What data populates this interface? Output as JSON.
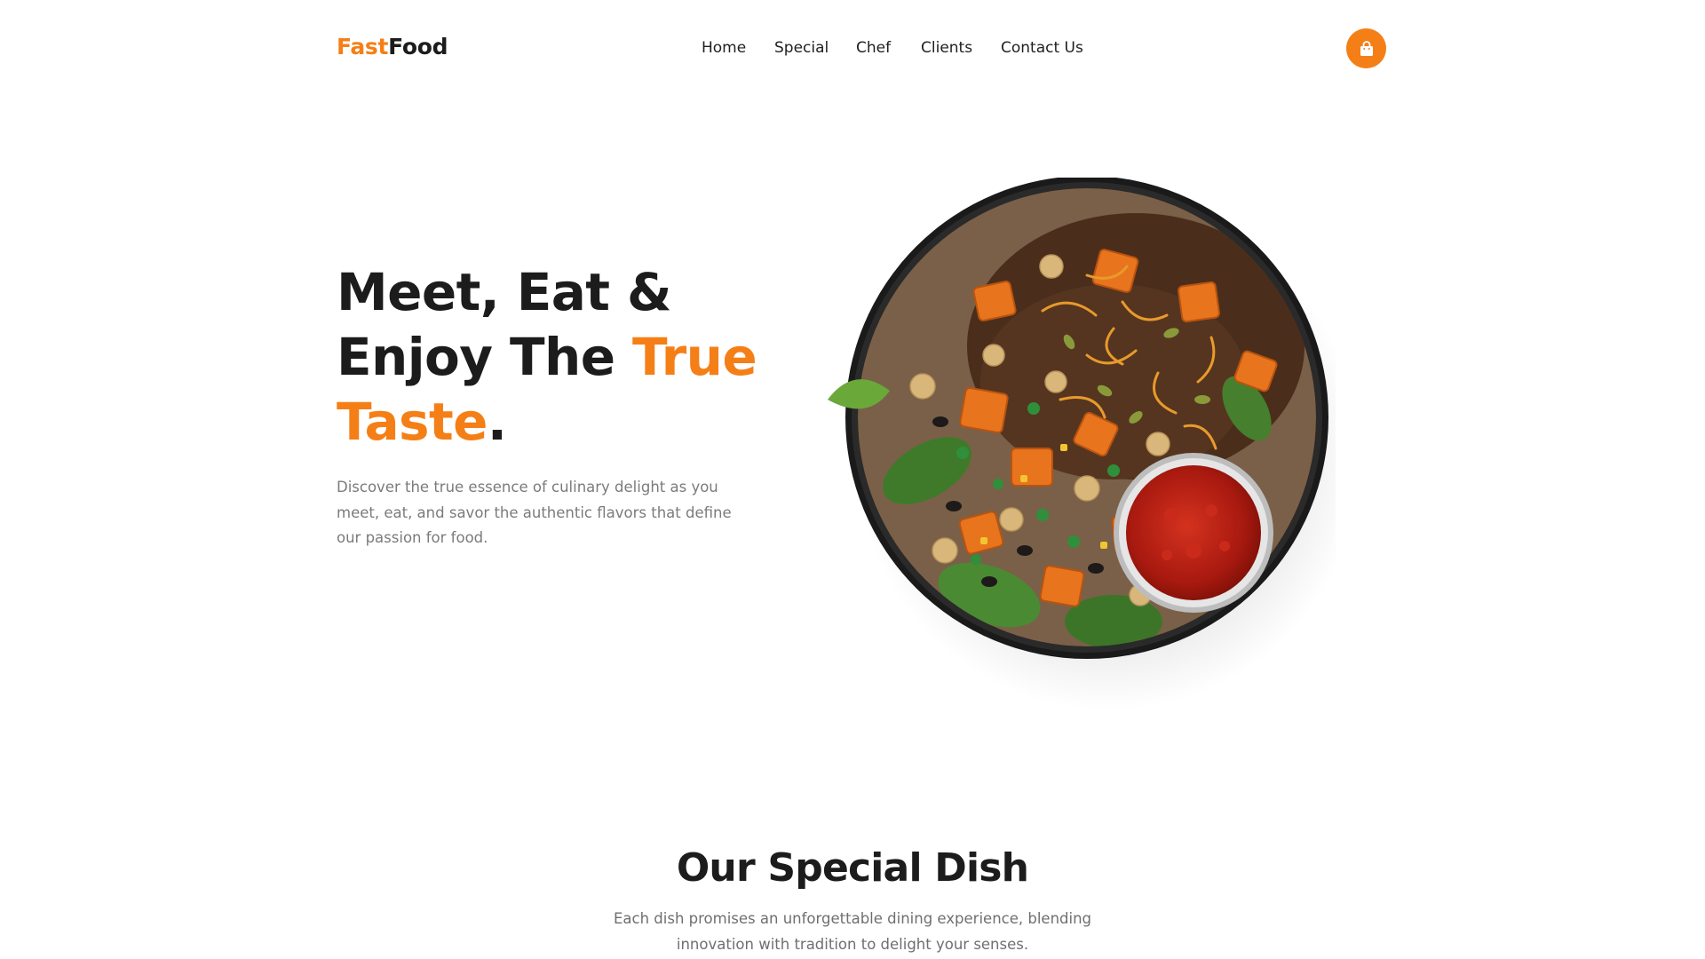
{
  "brand": {
    "part1": "Fast",
    "part2": "Food"
  },
  "nav": {
    "items": [
      {
        "label": "Home"
      },
      {
        "label": "Special"
      },
      {
        "label": "Chef"
      },
      {
        "label": "Clients"
      },
      {
        "label": "Contact Us"
      }
    ]
  },
  "cart": {
    "icon": "shopping-bag-icon"
  },
  "hero": {
    "title_line1": "Meet, Eat &",
    "title_line2_plain": "Enjoy The ",
    "title_line2_accent": "True",
    "title_line3_accent": "Taste",
    "title_line3_end": ".",
    "description": "Discover the true essence of culinary delight as you meet, eat, and savor the authentic flavors that define our passion for food."
  },
  "special": {
    "title": "Our Special Dish",
    "description": "Each dish promises an unforgettable dining experience, blending innovation with tradition to delight your senses."
  },
  "colors": {
    "accent": "#f57f17",
    "text": "#1c1c1c",
    "muted": "#7b7b7b"
  }
}
